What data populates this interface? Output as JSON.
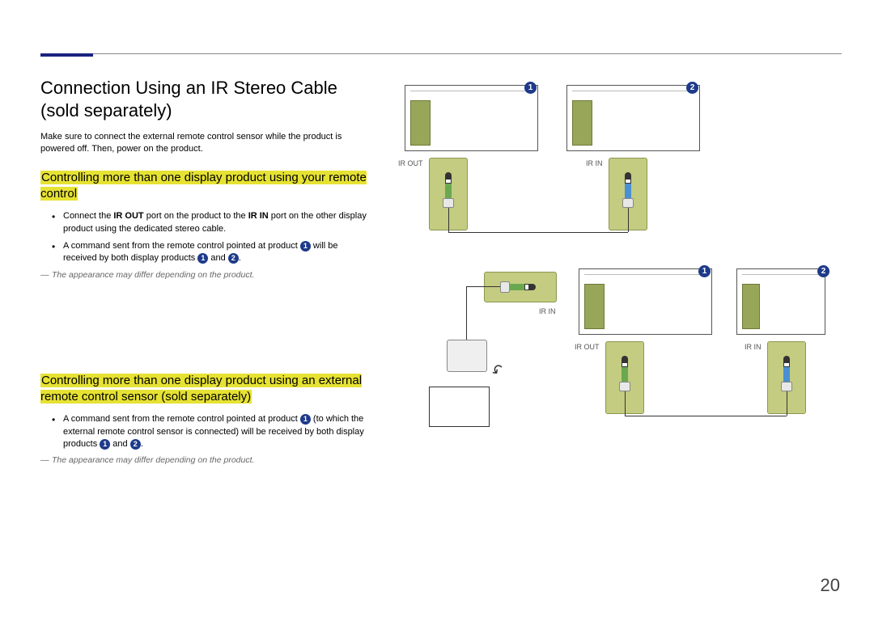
{
  "page_number": "20",
  "section_title": "Connection Using an IR Stereo Cable (sold separately)",
  "intro": "Make sure to connect the external remote control sensor while the product is powered off. Then, power on the product.",
  "sub1": {
    "heading": "Controlling more than one display product using your remote control",
    "b1_pre": "Connect the ",
    "b1_irout": "IR OUT",
    "b1_mid": " port on the product to the ",
    "b1_irin": "IR IN",
    "b1_post": " port on the other display product using the dedicated stereo cable.",
    "b2_pre": "A command sent from the remote control pointed at product ",
    "b2_mid": " will be received by both display products ",
    "b2_and": " and ",
    "b2_end": ".",
    "note": "The appearance may differ depending on the product."
  },
  "sub2": {
    "heading": "Controlling more than one display product using an external remote control sensor (sold separately)",
    "b1_pre": "A command sent from the remote control pointed at product ",
    "b1_mid": " (to which the external remote control sensor is connected) will be received by both display products ",
    "b1_and": " and ",
    "b1_end": ".",
    "note": "The appearance may differ depending on the product."
  },
  "labels": {
    "ir_out": "IR OUT",
    "ir_in": "IR IN",
    "badge1": "1",
    "badge2": "2"
  }
}
